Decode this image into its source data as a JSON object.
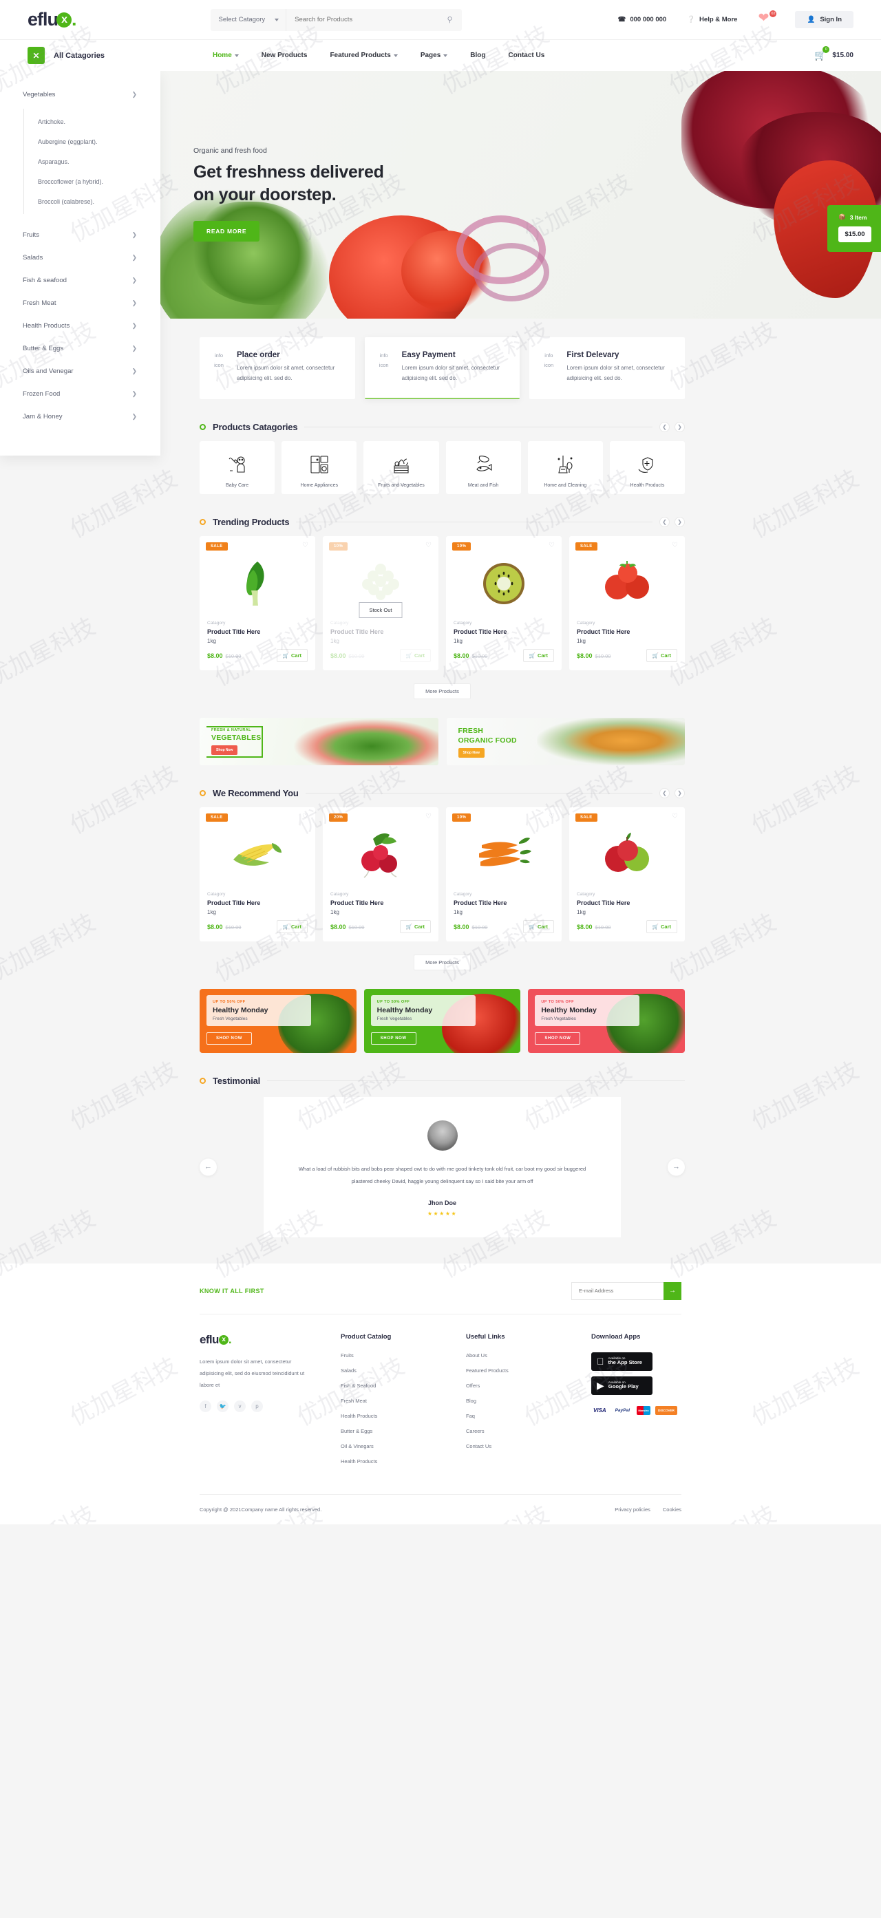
{
  "brand": {
    "name": "eflu",
    "mark": "x",
    "dot": "."
  },
  "header": {
    "select_category": "Select Catagory",
    "search_placeholder": "Search for Products",
    "search_icon": "search-icon",
    "phone": "000 000 000",
    "help": "Help & More",
    "wishlist_count": "02",
    "signin": "Sign In"
  },
  "nav": {
    "all_categories": "All Catagories",
    "items": [
      {
        "label": "Home",
        "caret": true,
        "active": true
      },
      {
        "label": "New Products",
        "caret": false,
        "active": false
      },
      {
        "label": "Featured Products",
        "caret": true,
        "active": false
      },
      {
        "label": "Pages",
        "caret": true,
        "active": false
      },
      {
        "label": "Blog",
        "caret": false,
        "active": false
      },
      {
        "label": "Contact Us",
        "caret": false,
        "active": false
      }
    ],
    "cart_count": "0",
    "cart_total": "$15.00"
  },
  "sidebar": {
    "items": [
      {
        "label": "Vegetables"
      },
      {
        "label": "Fruits"
      },
      {
        "label": "Salads"
      },
      {
        "label": "Fish & seafood"
      },
      {
        "label": "Fresh Meat"
      },
      {
        "label": "Health Products"
      },
      {
        "label": "Butter & Eggs"
      },
      {
        "label": "Oils and Venegar"
      },
      {
        "label": "Frozen Food"
      },
      {
        "label": "Jam & Honey"
      }
    ],
    "vegetable_sub": [
      "Artichoke.",
      "Aubergine (eggplant).",
      "Asparagus.",
      "Broccoflower (a hybrid).",
      "Broccoli (calabrese)."
    ]
  },
  "hero": {
    "eyebrow": "Organic and fresh food",
    "title_line1": "Get freshness delivered",
    "title_line2": "on your doorstep.",
    "button": "READ MORE",
    "cart_items": "3 Item",
    "cart_price": "$15.00"
  },
  "info_cards": [
    {
      "icon": "info icon",
      "title": "Place order",
      "text": "Lorem ipsum dolor sit amet, consectetur adipisicing elit. sed do."
    },
    {
      "icon": "info icon",
      "title": "Easy Payment",
      "text": "Lorem ipsum dolor sit amet, consectetur adipisicing elit. sed do."
    },
    {
      "icon": "info icon",
      "title": "First Delevary",
      "text": "Lorem ipsum dolor sit amet, consectetur adipisicing elit. sed do."
    }
  ],
  "categories_section": {
    "title": "Products Catagories",
    "items": [
      {
        "label": "Baby Care",
        "icon": "baby-care-icon"
      },
      {
        "label": "Home Appliances",
        "icon": "home-appliances-icon"
      },
      {
        "label": "Fruits and Vegetables",
        "icon": "fruits-vegetables-icon"
      },
      {
        "label": "Meat and Fish",
        "icon": "meat-fish-icon"
      },
      {
        "label": "Home and Cleaning",
        "icon": "home-cleaning-icon"
      },
      {
        "label": "Health Products",
        "icon": "health-products-icon"
      }
    ]
  },
  "trending": {
    "title": "Trending Products",
    "more_label": "More Products",
    "products": [
      {
        "tag": "SALE",
        "category": "Catagory",
        "title": "Product Title Here",
        "weight": "1kg",
        "price": "$8.00",
        "old_price": "$10.00",
        "cart": "Cart",
        "out_of_stock": false,
        "stock_label": "",
        "img": "bokchoy"
      },
      {
        "tag": "10%",
        "category": "Catagory",
        "title": "Product Title Here",
        "weight": "1kg",
        "price": "$8.00",
        "old_price": "$10.00",
        "cart": "Cart",
        "out_of_stock": true,
        "stock_label": "Stock Out",
        "img": "grapes"
      },
      {
        "tag": "10%",
        "category": "Catagory",
        "title": "Product Title Here",
        "weight": "1kg",
        "price": "$8.00",
        "old_price": "$10.00",
        "cart": "Cart",
        "out_of_stock": false,
        "stock_label": "",
        "img": "kiwi"
      },
      {
        "tag": "SALE",
        "category": "Catagory",
        "title": "Product Title Here",
        "weight": "1kg",
        "price": "$8.00",
        "old_price": "$10.00",
        "cart": "Cart",
        "out_of_stock": false,
        "stock_label": "",
        "img": "tomato"
      }
    ]
  },
  "mid_banners": [
    {
      "small": "FRESH & NATURAL",
      "big": "VEGETABLES",
      "button": "Shop Now"
    },
    {
      "small": "FRESH",
      "big": "ORGANIC FOOD",
      "button": "Shop Now"
    }
  ],
  "recommend": {
    "title": "We Recommend You",
    "more_label": "More Products",
    "products": [
      {
        "tag": "SALE",
        "category": "Catagory",
        "title": "Product Title Here",
        "weight": "1kg",
        "price": "$8.00",
        "old_price": "$10.00",
        "cart": "Cart",
        "img": "corn"
      },
      {
        "tag": "20%",
        "category": "Catagory",
        "title": "Product Title Here",
        "weight": "1kg",
        "price": "$8.00",
        "old_price": "$10.00",
        "cart": "Cart",
        "img": "radish"
      },
      {
        "tag": "10%",
        "category": "Catagory",
        "title": "Product Title Here",
        "weight": "1kg",
        "price": "$8.00",
        "old_price": "$10.00",
        "cart": "Cart",
        "img": "carrot"
      },
      {
        "tag": "SALE",
        "category": "Catagory",
        "title": "Product Title Here",
        "weight": "1kg",
        "price": "$8.00",
        "old_price": "$10.00",
        "cart": "Cart",
        "img": "apple"
      }
    ]
  },
  "deals": [
    {
      "off": "UP TO 50% OFF",
      "title": "Healthy Monday",
      "sub": "Fresh Vegetables",
      "button": "SHOP NOW",
      "color": "#f5701a"
    },
    {
      "off": "UP TO 50% OFF",
      "title": "Healthy Monday",
      "sub": "Fresh Vegetables",
      "button": "SHOP NOW",
      "color": "#4fb618"
    },
    {
      "off": "UP TO 50% OFF",
      "title": "Healthy Monday",
      "sub": "Fresh Vegetables",
      "button": "SHOP NOW",
      "color": "#f0505a"
    }
  ],
  "testimonial": {
    "title": "Testimonial",
    "quote": "What a load of rubbish bits and bobs pear shaped owt to do with me good tinkety tonk old fruit, car boot my good sir buggered plastered cheeky David, haggle young delinquent say so I said bite your arm off",
    "name": "Jhon Doe",
    "stars": "★★★★★"
  },
  "footer": {
    "newsletter_title": "KNOW IT ALL FIRST",
    "newsletter_placeholder": "E-mail Address",
    "newsletter_button": "→",
    "about": "Lorem ipsum dolor sit amet, consectetur adipisicing elit, sed do eiusmod teincididunt ut labore et",
    "socials": [
      "f",
      "t",
      "v",
      "p"
    ],
    "columns": [
      {
        "head": "Product Catalog",
        "links": [
          "Fruits",
          "Salads",
          "Fish & Seafood",
          "Fresh Meat",
          "Health Products",
          "Butter & Eggs",
          "Oil & Vinegars",
          "Health Products"
        ]
      },
      {
        "head": "Useful Links",
        "links": [
          "About Us",
          "Featured Products",
          "Offers",
          "Blog",
          "Faq",
          "Careers",
          "Contact Us"
        ]
      }
    ],
    "apps_head": "Download Apps",
    "apps": [
      {
        "small": "Available on",
        "big": "the App Store",
        "icon": "apple-icon"
      },
      {
        "small": "Available on",
        "big": "Google Play",
        "icon": "google-play-icon"
      }
    ],
    "payments": [
      "VISA",
      "PayPal",
      "Maestro",
      "DISCOVER"
    ],
    "copyright": "Copyright @ 2021Company name All rights reserved.",
    "copy_links": [
      "Privacy policies",
      "Cookies"
    ]
  },
  "colors": {
    "green": "#4fb618",
    "orange": "#f08019",
    "red": "#f0505a",
    "dark": "#26282f"
  }
}
